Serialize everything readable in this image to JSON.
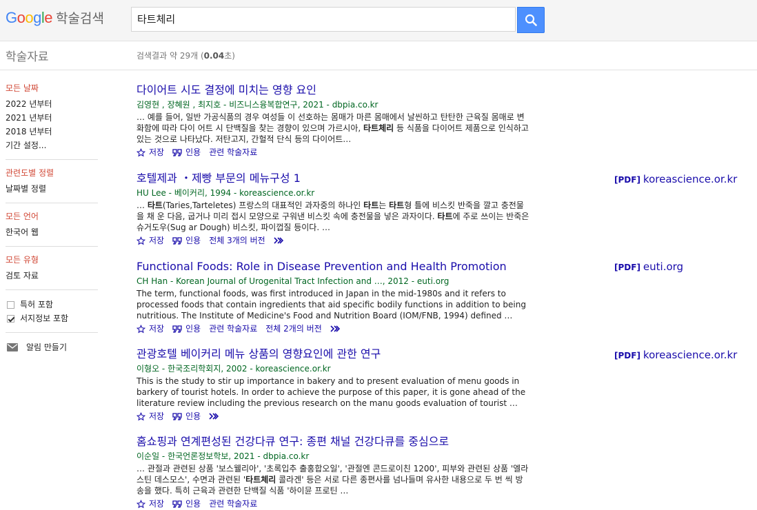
{
  "header": {
    "logo_google": "Google",
    "logo_scholar": "학술검색",
    "search_value": "타트체리",
    "search_button_label": ""
  },
  "subbar": {
    "section_title": "학술자료",
    "stats_prefix": "검색결과 약 29개 (",
    "stats_time": "0.04",
    "stats_suffix": "초)"
  },
  "sidebar": {
    "date": {
      "head": "모든 날짜",
      "items": [
        "2022 년부터",
        "2021 년부터",
        "2018 년부터",
        "기간 설정..."
      ]
    },
    "sort": {
      "head": "관련도별 정렬",
      "items": [
        "날짜별 정렬"
      ]
    },
    "lang": {
      "head": "모든 언어",
      "items": [
        "한국어 웹"
      ]
    },
    "type": {
      "head": "모든 유형",
      "items": [
        "검토 자료"
      ]
    },
    "checks": [
      {
        "label": "특허 포함",
        "checked": false
      },
      {
        "label": "서지정보 포함",
        "checked": true
      }
    ],
    "alert_label": "알림 만들기"
  },
  "results": [
    {
      "title": "다이어트 시도 결정에 미치는 영향 요인",
      "meta": "김영현 ,  장혜원 ,  최지호 - 비즈니스융복합연구, 2021 - dbpia.co.kr",
      "snippet_html": "… 예를 들어, 일반 가공식품의 경우 여성들 이 선호하는 몸매가 마른 몸매에서 날씬하고 탄탄한 근육질 몸매로 변화함에 따라 다이 어트 시 단백질을 찾는 경향이 있으며 가르시아, <b>타트체리</b> 등 식품을 다이어트 제품으로 인식하고 있는 것으로 나타났다. 저탄고지, 간헐적 단식 등의 다이어트…",
      "actions": [
        "저장",
        "인용",
        "관련 학술자료"
      ],
      "more": false,
      "pdf": null
    },
    {
      "title": "호텔제과 ・제빵 부문의 메뉴구성 1",
      "meta": "HU Lee - 베이커리, 1994 - koreascience.or.kr",
      "snippet_html": "… <b>타트</b>(Taries,Tarteletes) 프랑스의 대표적인 과자중의 하나인 <b>타트</b>는 <b>타트</b>형 틀에 비스킷 반죽을 깔고 충전물을 채 운 다음, 굽거나 미리 접시 모양으로 구워낸 비스킷 속에 충전물을 넣은 과자이다. <b>타트</b>에 주로 쓰이는 반죽은 슈거도우(Sug ar Dough) 비스킷, 파이껍질 등이다. …",
      "actions": [
        "저장",
        "인용",
        "전체 3개의 버전"
      ],
      "more": true,
      "pdf": {
        "tag": "[PDF]",
        "site": "koreascience.or.kr"
      }
    },
    {
      "title": "Functional Foods: Role in Disease Prevention and Health Promotion",
      "meta": "CH Han - Korean Journal of Urogenital Tract Infection and …, 2012 - euti.org",
      "snippet_html": "The term, functional foods, was first introduced in Japan in the mid-1980s and it refers to processed foods that contain ingredients that aid specific bodily functions in addition to being nutritious. The Institute of Medicine's Food and Nutrition Board (IOM/FNB, 1994) defined …",
      "actions": [
        "저장",
        "인용",
        "관련 학술자료",
        "전체 2개의 버전"
      ],
      "more": true,
      "pdf": {
        "tag": "[PDF]",
        "site": "euti.org"
      }
    },
    {
      "title": "관광호텔 베이커리 메뉴 상품의 영향요인에 관한 연구",
      "meta": "이형오 - 한국조리학회지, 2002 - koreascience.or.kr",
      "snippet_html": "This is the study to stir up importance in bakery and to present evaluation of menu goods in barkery of tourist hotels. In order to achieve the purpose of this paper, it is gone ahead of the literature review including the previous research on the manu goods evaluation of tourist …",
      "actions": [
        "저장",
        "인용"
      ],
      "more": true,
      "pdf": {
        "tag": "[PDF]",
        "site": "koreascience.or.kr"
      }
    },
    {
      "title": "홈쇼핑과 연계편성된 건강다큐 연구: 종편 채널 건강다큐를 중심으로",
      "meta": "이순일 - 한국언론정보학보, 2021 - dbpia.co.kr",
      "snippet_html": "… 관절과 관련된 상품 '보스웰리아', '초록입추 출홍합오일', '관절엔 콘드로이친 1200', 피부와 관련된 상품 '엘라스틴 데스모스', 수면과 관련된 '<b>타트체리</b> 콜라겐' 등은 서로 다른 종편사를 넘나들며 유사한 내용으로 두 번 씩 방 송을 했다. 특히 근육과 관련한 단백질 식품 '하이뮨 프로틴 …",
      "actions": [
        "저장",
        "인용",
        "관련 학술자료"
      ],
      "more": false,
      "pdf": null
    }
  ],
  "colors": {
    "link": "#1a0dab",
    "meta": "#006621",
    "sidebar_head": "#d14836",
    "search_button": "#4d90fe"
  }
}
